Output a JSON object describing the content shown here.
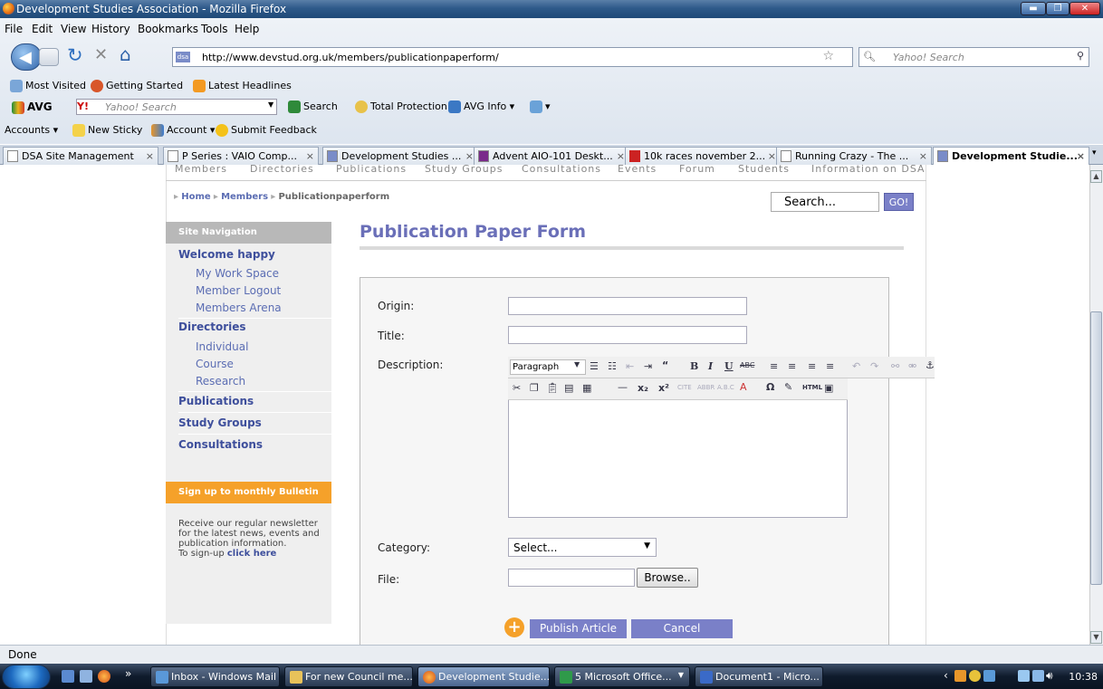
{
  "window": {
    "title": "Development Studies Association - Mozilla Firefox",
    "min": "▬",
    "max": "❐",
    "close": "✕"
  },
  "menu": [
    "File",
    "Edit",
    "View",
    "History",
    "Bookmarks",
    "Tools",
    "Help"
  ],
  "nav": {
    "url": "http://www.devstud.org.uk/members/publicationpaperform/",
    "search_placeholder": "Yahoo! Search",
    "favicon": "dsa"
  },
  "bookmarks": [
    "Most Visited",
    "Getting Started",
    "Latest Headlines"
  ],
  "avg": {
    "label": "AVG",
    "search_placeholder": "Yahoo! Search",
    "search": "Search",
    "protection": "Total Protection",
    "info": "AVG Info"
  },
  "accounts": {
    "accounts": "Accounts",
    "sticky": "New Sticky",
    "account": "Account",
    "feedback": "Submit Feedback"
  },
  "tabs": [
    {
      "label": "DSA Site Management"
    },
    {
      "label": "P Series : VAIO Comp..."
    },
    {
      "label": "Development Studies ..."
    },
    {
      "label": "Advent AIO-101 Deskt..."
    },
    {
      "label": "10k races november 2..."
    },
    {
      "label": "Running Crazy - The ..."
    },
    {
      "label": "Development Studie..."
    }
  ],
  "site": {
    "topnav": [
      "Members",
      "Directories",
      "Publications",
      "Study Groups",
      "Consultations",
      "Events",
      "Forum",
      "Students",
      "Information on DSA"
    ],
    "breadcrumb": {
      "home": "Home",
      "members": "Members",
      "current": "Publicationpaperform"
    },
    "search_value": "Search...",
    "go": "GO!",
    "sidenav_title": "Site Navigation",
    "sidenav": {
      "welcome": "Welcome happy",
      "workspace": "My Work Space",
      "logout": "Member Logout",
      "arena": "Members Arena",
      "directories": "Directories",
      "individual": "Individual",
      "course": "Course",
      "research": "Research",
      "publications": "Publications",
      "study_groups": "Study Groups",
      "consultations": "Consultations"
    },
    "bulletin_title": "Sign up to monthly Bulletin",
    "bulletin_text": "Receive our regular newsletter for the latest news, events and publication information.",
    "bulletin_signup": "To sign-up",
    "bulletin_link": "click here",
    "page_title": "Publication Paper Form",
    "form": {
      "origin": "Origin:",
      "title": "Title:",
      "description": "Description:",
      "category": "Category:",
      "category_value": "Select...",
      "file": "File:",
      "browse": "Browse..",
      "publish": "Publish Article",
      "cancel": "Cancel",
      "paragraph": "Paragraph"
    }
  },
  "status": "Done",
  "taskbar": [
    {
      "label": "Inbox - Windows Mail"
    },
    {
      "label": "For new Council me..."
    },
    {
      "label": "Development Studie..."
    },
    {
      "label": "5 Microsoft Office..."
    },
    {
      "label": "Document1 - Micro..."
    }
  ],
  "clock": "10:38"
}
